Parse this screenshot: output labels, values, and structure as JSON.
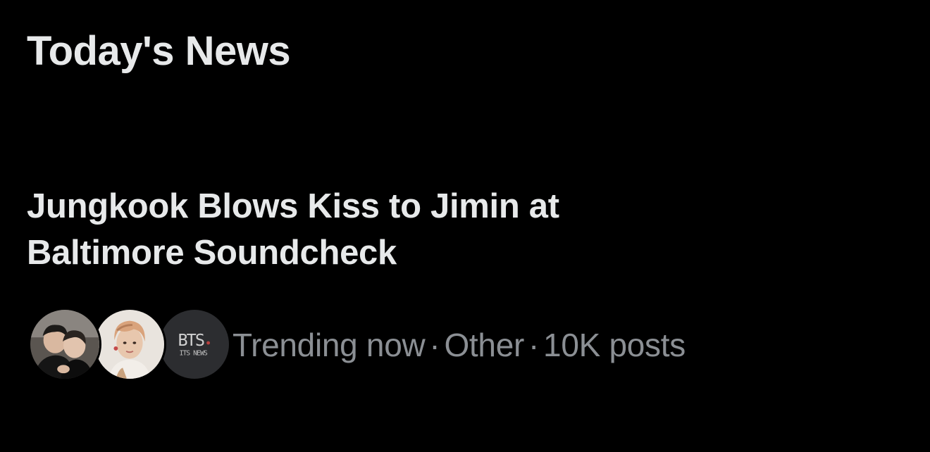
{
  "section": {
    "title": "Today's News"
  },
  "news_item": {
    "headline_line1": "Jungkook Blows Kiss to Jimin at",
    "headline_line2": "Baltimore Soundcheck",
    "meta": {
      "status": "Trending now",
      "separator": "·",
      "category": "Other",
      "count": "10K posts"
    },
    "avatars": [
      {
        "icon": "photo-avatar-two-people"
      },
      {
        "icon": "photo-avatar-person"
      },
      {
        "icon": "logo-avatar-bts-news",
        "logo_text_top": "BTS",
        "logo_text_bottom": "ITS NEWS"
      }
    ]
  },
  "colors": {
    "background": "#000000",
    "primary_text": "#e7e9ea",
    "secondary_text": "#8b8f94"
  }
}
